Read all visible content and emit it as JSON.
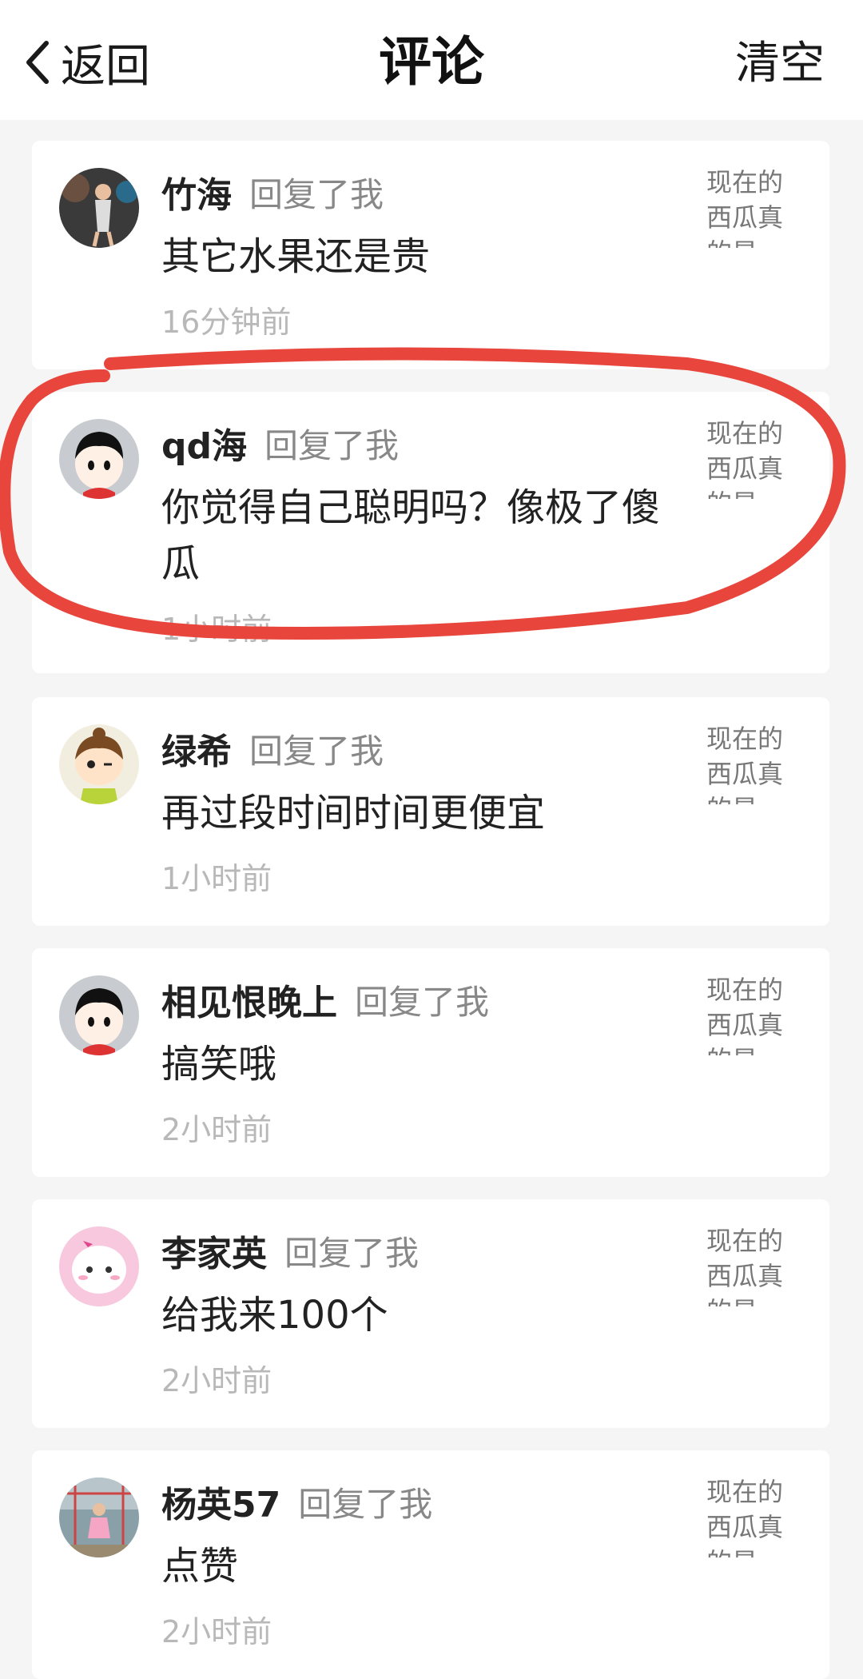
{
  "header": {
    "back_label": "返回",
    "title": "评论",
    "clear_label": "清空"
  },
  "comments": [
    {
      "username": "竹海",
      "action": "回复了我",
      "text": "其它水果还是贵",
      "time": "16分钟前",
      "quote": "现在的西瓜真的是"
    },
    {
      "username": "qd海",
      "action": "回复了我",
      "text": "你觉得自己聪明吗？像极了傻瓜",
      "time": "1小时前",
      "quote": "现在的西瓜真的是"
    },
    {
      "username": "绿希",
      "action": "回复了我",
      "text": "再过段时间时间更便宜",
      "time": "1小时前",
      "quote": "现在的西瓜真的是"
    },
    {
      "username": "相见恨晚上",
      "action": "回复了我",
      "text": "搞笑哦",
      "time": "2小时前",
      "quote": "现在的西瓜真的是"
    },
    {
      "username": "李家英",
      "action": "回复了我",
      "text": "给我来100个",
      "time": "2小时前",
      "quote": "现在的西瓜真的是"
    },
    {
      "username": "杨英57",
      "action": "回复了我",
      "text": "点赞",
      "time": "2小时前",
      "quote": "现在的西瓜真的是"
    }
  ],
  "icons": {
    "back": "chevron-left-icon",
    "annotation": "red-circle-annotation"
  },
  "colors": {
    "annotation": "#e8453c",
    "time": "#b8b8b8",
    "action": "#888888"
  }
}
